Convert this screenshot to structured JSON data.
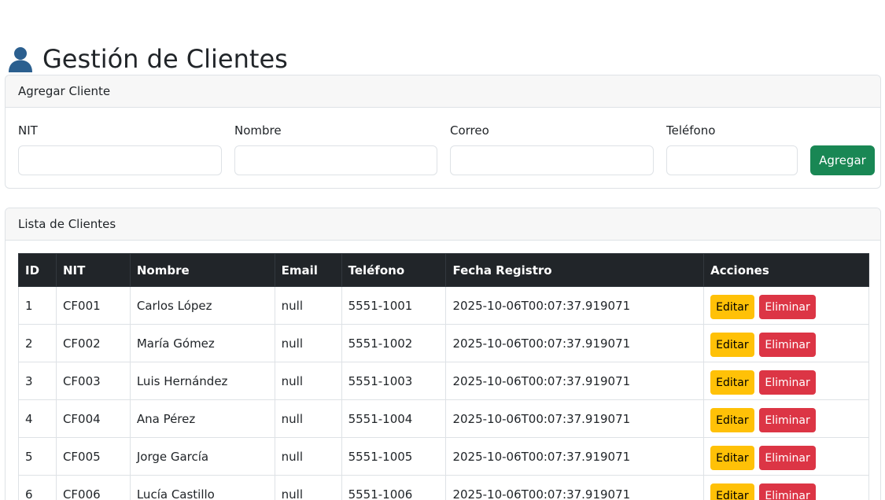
{
  "page": {
    "title": "Gestión de Clientes",
    "title_icon": "user-icon"
  },
  "add_card": {
    "header": "Agregar Cliente",
    "fields": {
      "nit": {
        "label": "NIT",
        "value": ""
      },
      "nombre": {
        "label": "Nombre",
        "value": ""
      },
      "correo": {
        "label": "Correo",
        "value": ""
      },
      "telefono": {
        "label": "Teléfono",
        "value": ""
      }
    },
    "submit_label": "Agregar"
  },
  "list_card": {
    "header": "Lista de Clientes",
    "columns": [
      "ID",
      "NIT",
      "Nombre",
      "Email",
      "Teléfono",
      "Fecha Registro",
      "Acciones"
    ],
    "edit_label": "Editar",
    "delete_label": "Eliminar",
    "rows": [
      {
        "id": "1",
        "nit": "CF001",
        "nombre": "Carlos López",
        "email": "null",
        "telefono": "5551-1001",
        "fecha": "2025-10-06T00:07:37.919071"
      },
      {
        "id": "2",
        "nit": "CF002",
        "nombre": "María Gómez",
        "email": "null",
        "telefono": "5551-1002",
        "fecha": "2025-10-06T00:07:37.919071"
      },
      {
        "id": "3",
        "nit": "CF003",
        "nombre": "Luis Hernández",
        "email": "null",
        "telefono": "5551-1003",
        "fecha": "2025-10-06T00:07:37.919071"
      },
      {
        "id": "4",
        "nit": "CF004",
        "nombre": "Ana Pérez",
        "email": "null",
        "telefono": "5551-1004",
        "fecha": "2025-10-06T00:07:37.919071"
      },
      {
        "id": "5",
        "nit": "CF005",
        "nombre": "Jorge García",
        "email": "null",
        "telefono": "5551-1005",
        "fecha": "2025-10-06T00:07:37.919071"
      },
      {
        "id": "6",
        "nit": "CF006",
        "nombre": "Lucía Castillo",
        "email": "null",
        "telefono": "5551-1006",
        "fecha": "2025-10-06T00:07:37.919071"
      }
    ]
  },
  "colors": {
    "success": "#198754",
    "warning": "#ffc107",
    "danger": "#dc3545",
    "table_header": "#212529",
    "icon_blue": "#2b5f8f"
  }
}
